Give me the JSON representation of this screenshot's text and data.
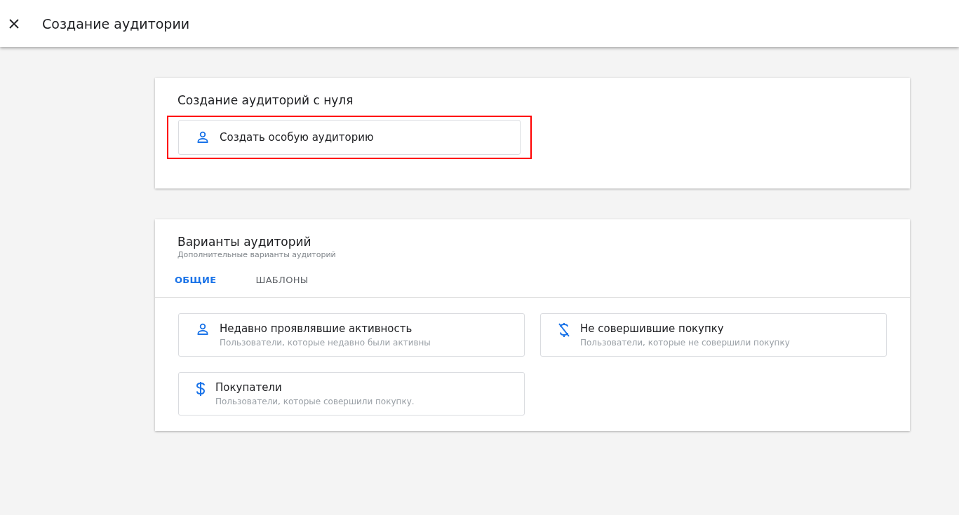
{
  "header": {
    "title": "Создание аудитории"
  },
  "scratch": {
    "title": "Создание аудиторий с нуля",
    "button": {
      "label": "Создать особую аудиторию",
      "kind": "person",
      "highlighted": true
    }
  },
  "suggested": {
    "title": "Варианты аудиторий",
    "subtitle": "Дополнительные варианты аудиторий",
    "tabs": [
      {
        "label": "ОБЩИЕ",
        "selected": true
      },
      {
        "label": "ШАБЛОНЫ",
        "selected": false
      }
    ],
    "options": [
      {
        "title": "Недавно проявлявшие активность",
        "description": "Пользователи, которые недавно были активны",
        "kind": "person"
      },
      {
        "title": "Не совершившие покупку",
        "description": "Пользователи, которые не совершили покупку",
        "kind": "no-dollar"
      },
      {
        "title": "Покупатели",
        "description": "Пользователи, которые совершили покупку.",
        "kind": "dollar"
      }
    ]
  }
}
